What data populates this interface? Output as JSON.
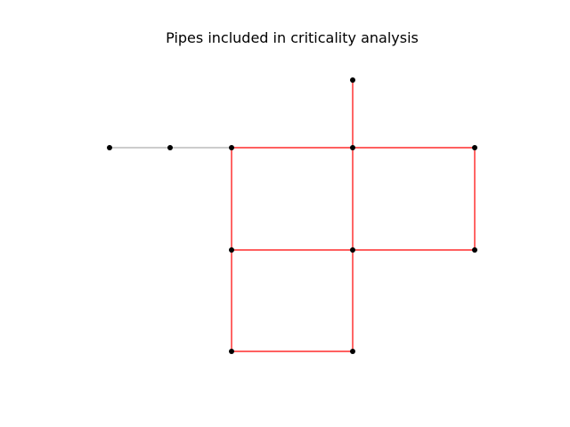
{
  "title": "Pipes included in criticality analysis",
  "colors": {
    "background": "#ffffff",
    "node": "#000000",
    "pipe_included": "#ff0000",
    "pipe_excluded": "#9a9a9a"
  },
  "network": {
    "nodes": [
      {
        "id": "n1"
      },
      {
        "id": "n2"
      },
      {
        "id": "n3"
      },
      {
        "id": "n4"
      },
      {
        "id": "n5"
      },
      {
        "id": "n6"
      },
      {
        "id": "n7"
      },
      {
        "id": "n8"
      },
      {
        "id": "n9"
      },
      {
        "id": "n10"
      },
      {
        "id": "n11"
      }
    ],
    "pipes": [
      {
        "id": "p1",
        "from": "n1",
        "to": "n2",
        "included": false
      },
      {
        "id": "p2",
        "from": "n2",
        "to": "n3",
        "included": false
      },
      {
        "id": "p3",
        "from": "n4",
        "to": "n5",
        "included": true
      },
      {
        "id": "p4",
        "from": "n3",
        "to": "n5",
        "included": true
      },
      {
        "id": "p5",
        "from": "n5",
        "to": "n6",
        "included": true
      },
      {
        "id": "p6",
        "from": "n6",
        "to": "n9",
        "included": true
      },
      {
        "id": "p7",
        "from": "n8",
        "to": "n9",
        "included": true
      },
      {
        "id": "p8",
        "from": "n7",
        "to": "n8",
        "included": true
      },
      {
        "id": "p9",
        "from": "n3",
        "to": "n7",
        "included": true
      },
      {
        "id": "p10",
        "from": "n5",
        "to": "n8",
        "included": true
      },
      {
        "id": "p11",
        "from": "n7",
        "to": "n10",
        "included": true
      },
      {
        "id": "p12",
        "from": "n10",
        "to": "n11",
        "included": true
      },
      {
        "id": "p13",
        "from": "n8",
        "to": "n11",
        "included": true
      }
    ]
  }
}
